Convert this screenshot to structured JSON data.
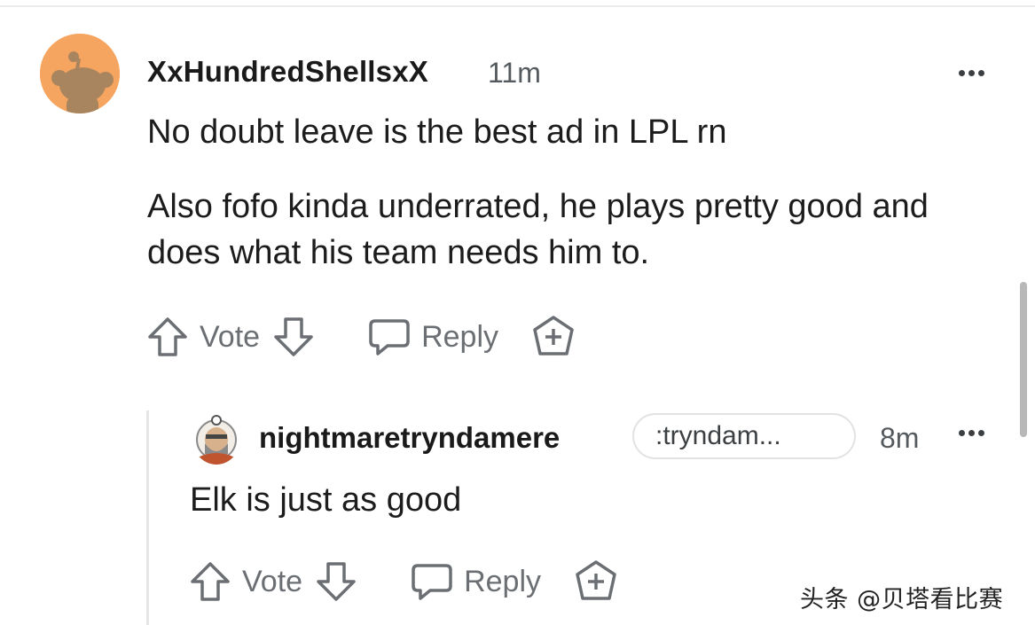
{
  "comment": {
    "username": "XxHundredShellsxX",
    "time": "11m",
    "paragraphs": [
      "No doubt leave is the best ad in LPL rn",
      "Also fofo kinda underrated, he plays pretty good and does what his team needs him to."
    ],
    "actions": {
      "vote_label": "Vote",
      "reply_label": "Reply"
    },
    "avatar_color": "#f5a55f"
  },
  "reply": {
    "username": "nightmaretryndamere",
    "flair": ":tryndam...",
    "time": "8m",
    "text": "Elk is just as good",
    "actions": {
      "vote_label": "Vote",
      "reply_label": "Reply"
    }
  },
  "watermark": "头条 @贝塔看比赛",
  "icons": [
    "upvote-icon",
    "downvote-icon",
    "reply-bubble-icon",
    "award-icon",
    "more-options-icon"
  ]
}
